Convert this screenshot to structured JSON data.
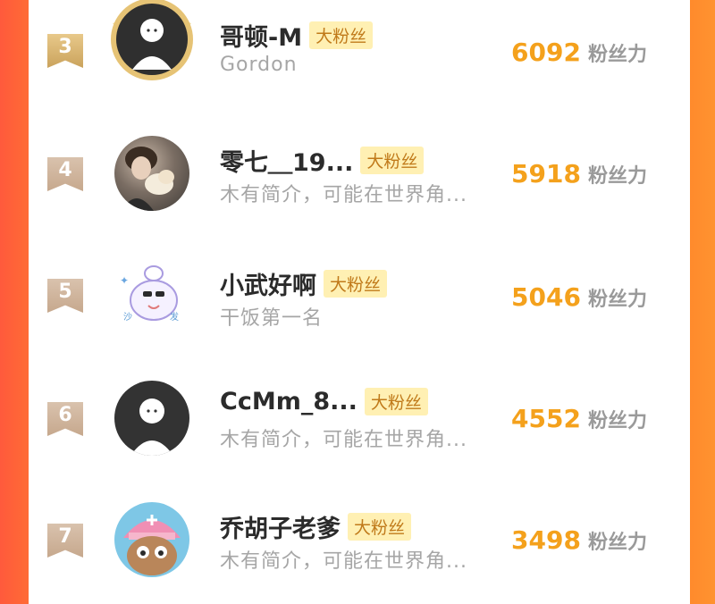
{
  "leaderboard": {
    "rows": [
      {
        "rank": "3",
        "name": "哥顿-M",
        "badge": "大粉丝",
        "desc": "Gordon",
        "score": "6092",
        "unit": "粉丝力"
      },
      {
        "rank": "4",
        "name": "零七＿19...",
        "badge": "大粉丝",
        "desc": "木有简介，可能在世界角...",
        "score": "5918",
        "unit": "粉丝力"
      },
      {
        "rank": "5",
        "name": "小武好啊",
        "badge": "大粉丝",
        "desc": "干饭第一名",
        "score": "5046",
        "unit": "粉丝力"
      },
      {
        "rank": "6",
        "name": "CcMm_8...",
        "badge": "大粉丝",
        "desc": "木有简介，可能在世界角...",
        "score": "4552",
        "unit": "粉丝力"
      },
      {
        "rank": "7",
        "name": "乔胡子老爹",
        "badge": "大粉丝",
        "desc": "木有简介，可能在世界角...",
        "score": "3498",
        "unit": "粉丝力"
      }
    ]
  },
  "colors": {
    "score": "#f4a11c",
    "badge_bg": "#fff0b3",
    "badge_text": "#c07a1a",
    "frame_left": "#ff5a3c",
    "frame_right": "#ff9330"
  }
}
